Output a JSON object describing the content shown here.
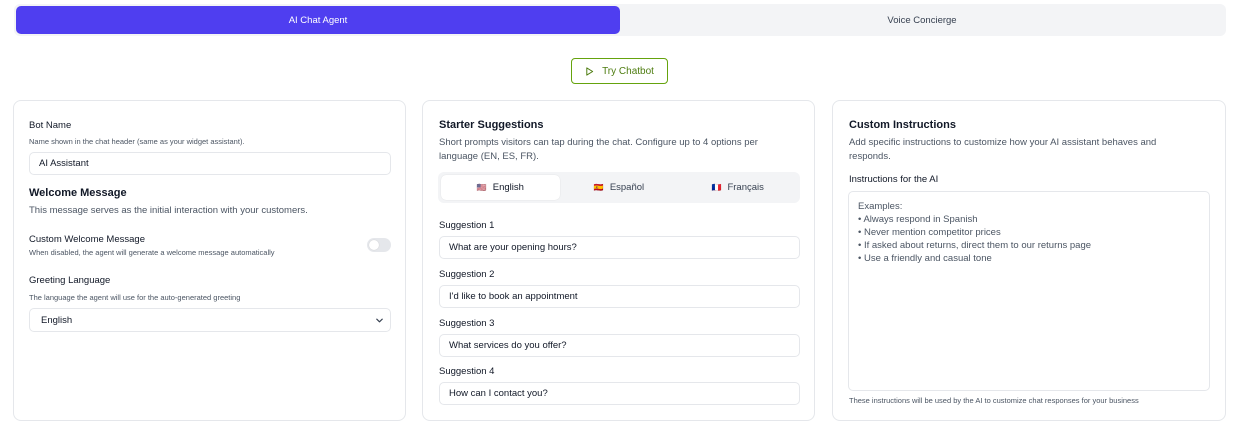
{
  "tabs": [
    {
      "label": "AI Chat Agent"
    },
    {
      "label": "Voice Concierge"
    }
  ],
  "try_button": {
    "label": "Try Chatbot"
  },
  "bot_config": {
    "bot_name_label": "Bot Name",
    "bot_name_hint": "Name shown in the chat header (same as your widget assistant).",
    "bot_name_value": "AI Assistant",
    "welcome_title": "Welcome Message",
    "welcome_desc": "This message serves as the initial interaction with your customers.",
    "custom_welcome_label": "Custom Welcome Message",
    "custom_welcome_hint": "When disabled, the agent will generate a welcome message automatically",
    "custom_welcome_enabled": false,
    "greeting_label": "Greeting Language",
    "greeting_hint": "The language the agent will use for the auto-generated greeting",
    "greeting_value": "English"
  },
  "starter": {
    "title": "Starter Suggestions",
    "desc": "Short prompts visitors can tap during the chat. Configure up to 4 options per language (EN, ES, FR).",
    "languages": [
      {
        "flag": "🇺🇸",
        "label": "English"
      },
      {
        "flag": "🇪🇸",
        "label": "Español"
      },
      {
        "flag": "🇫🇷",
        "label": "Français"
      }
    ],
    "suggestions": [
      {
        "label": "Suggestion 1",
        "value": "What are your opening hours?"
      },
      {
        "label": "Suggestion 2",
        "value": "I'd like to book an appointment"
      },
      {
        "label": "Suggestion 3",
        "value": "What services do you offer?"
      },
      {
        "label": "Suggestion 4",
        "value": "How can I contact you?"
      }
    ]
  },
  "custom": {
    "title": "Custom Instructions",
    "desc": "Add specific instructions to customize how your AI assistant behaves and responds.",
    "instructions_label": "Instructions for the AI",
    "placeholder": "Examples:\n• Always respond in Spanish\n• Never mention competitor prices\n• If asked about returns, direct them to our returns page\n• Use a friendly and casual tone",
    "footer": "These instructions will be used by the AI to customize chat responses for your business"
  },
  "colors": {
    "accent": "#4f3ef0",
    "try_button": "#65a30d"
  },
  "icons": {
    "try_button": "play-icon",
    "select": "chevron-down-icon"
  }
}
